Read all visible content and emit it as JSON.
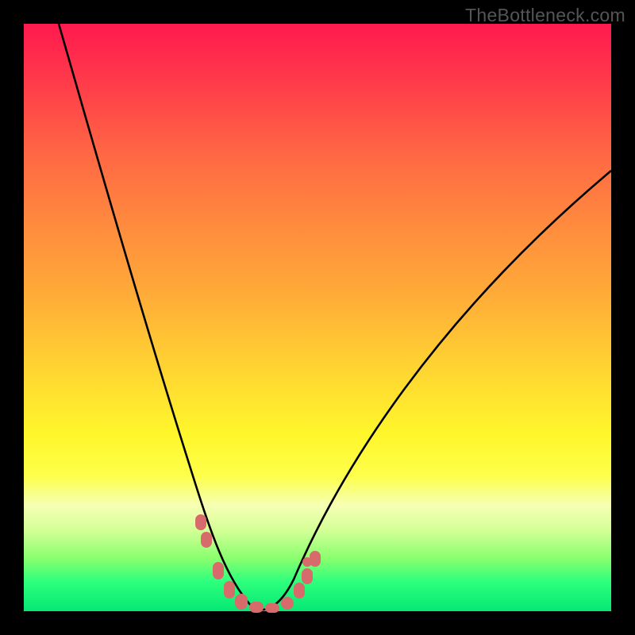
{
  "watermark": "TheBottleneck.com",
  "chart_data": {
    "type": "line",
    "title": "",
    "xlabel": "",
    "ylabel": "",
    "xlim": [
      0,
      100
    ],
    "ylim": [
      0,
      100
    ],
    "series": [
      {
        "name": "bottleneck-curve",
        "x": [
          6,
          10,
          14,
          18,
          22,
          25,
          28,
          30,
          32,
          34,
          36,
          38,
          40,
          43,
          47,
          52,
          58,
          64,
          70,
          76,
          82,
          88,
          94,
          100
        ],
        "values": [
          100,
          90,
          79,
          67,
          55,
          44,
          33,
          24,
          16,
          9,
          4,
          1,
          0,
          1,
          4,
          10,
          18,
          27,
          36,
          45,
          53,
          61,
          68,
          75
        ]
      }
    ],
    "markers": {
      "name": "highlight-dots",
      "color": "#d76a6a",
      "x": [
        30,
        31,
        33,
        35,
        37,
        39,
        41,
        43,
        45,
        47,
        49
      ],
      "values": [
        10,
        8,
        5,
        3,
        1.5,
        0.7,
        0.5,
        1,
        2.5,
        5,
        8
      ]
    },
    "colors": {
      "gradient_top": "#ff1a4e",
      "gradient_mid": "#fff72c",
      "gradient_bottom": "#05e874",
      "curve": "#000000",
      "marker": "#d76a6a",
      "background": "#000000"
    }
  }
}
